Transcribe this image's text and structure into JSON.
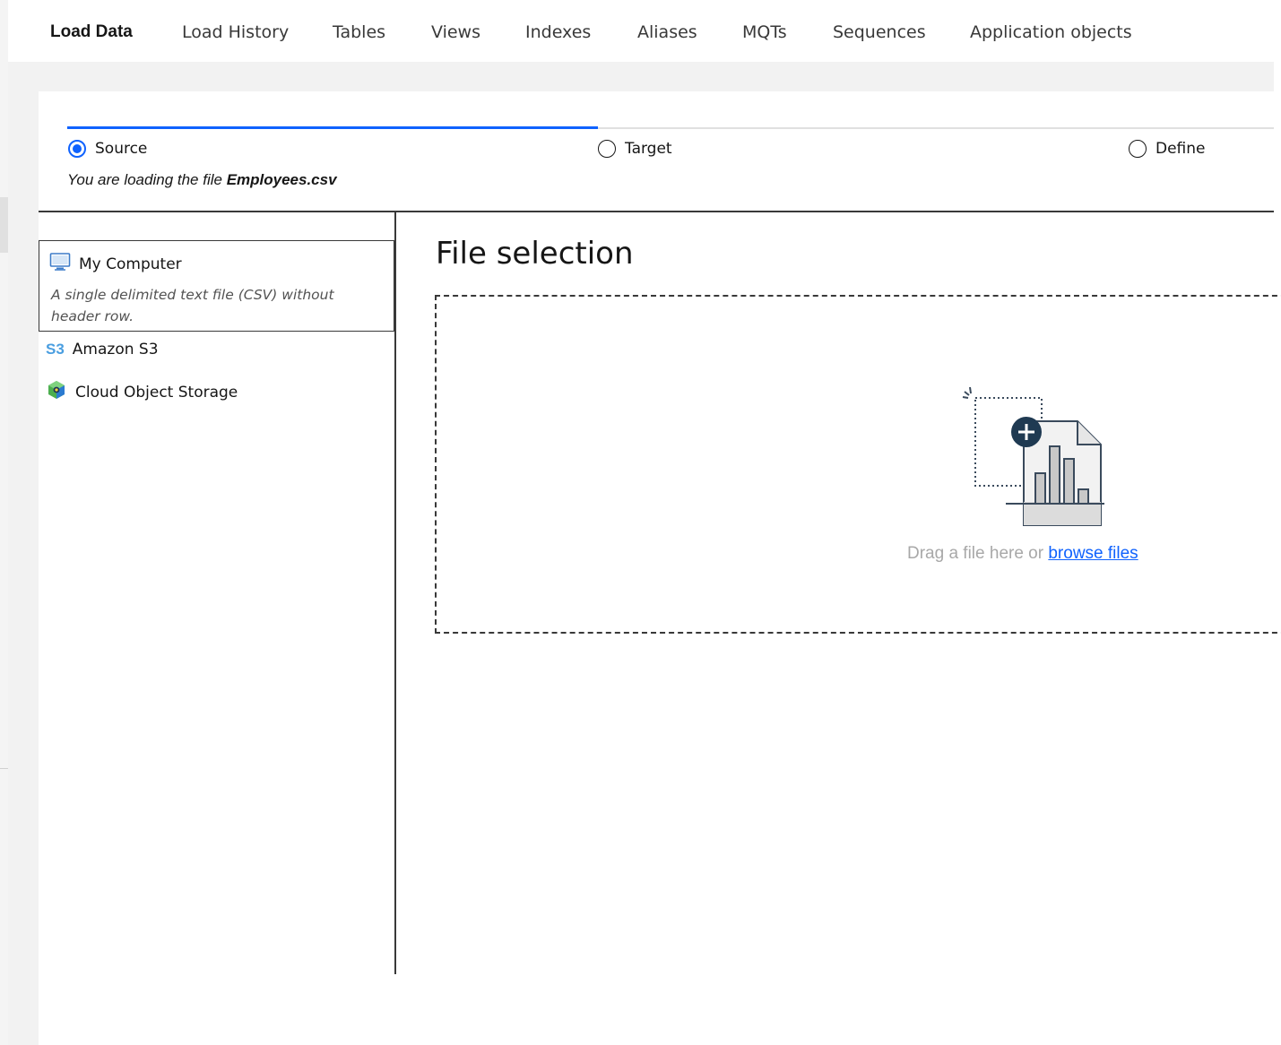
{
  "nav": {
    "tabs": [
      {
        "label": "Load Data",
        "active": true
      },
      {
        "label": "Load History"
      },
      {
        "label": "Tables"
      },
      {
        "label": "Views"
      },
      {
        "label": "Indexes"
      },
      {
        "label": "Aliases"
      },
      {
        "label": "MQTs"
      },
      {
        "label": "Sequences"
      },
      {
        "label": "Application objects"
      }
    ]
  },
  "wizard": {
    "steps": [
      {
        "label": "Source",
        "checked": true
      },
      {
        "label": "Target",
        "checked": false
      },
      {
        "label": "Define",
        "checked": false
      }
    ],
    "progress_fraction": 0.44,
    "loading_prefix": "You are loading the file ",
    "loading_file": "Employees.csv"
  },
  "sources": {
    "items": [
      {
        "label": "My Computer",
        "icon": "monitor-icon",
        "description": "A single delimited text file (CSV) without header row.",
        "selected": true
      },
      {
        "label": "Amazon S3",
        "icon": "s3-icon",
        "badge": "S3"
      },
      {
        "label": "Cloud Object Storage",
        "icon": "cloud-object-storage-icon"
      }
    ]
  },
  "file_selection": {
    "title": "File selection",
    "drop_prefix": "Drag a file here or ",
    "browse_label": "browse files",
    "icon": "upload-file-chart-icon"
  },
  "colors": {
    "accent": "#0f62fe",
    "text": "#161616",
    "muted": "#a8a8a8",
    "background_band": "#f2f2f2"
  }
}
